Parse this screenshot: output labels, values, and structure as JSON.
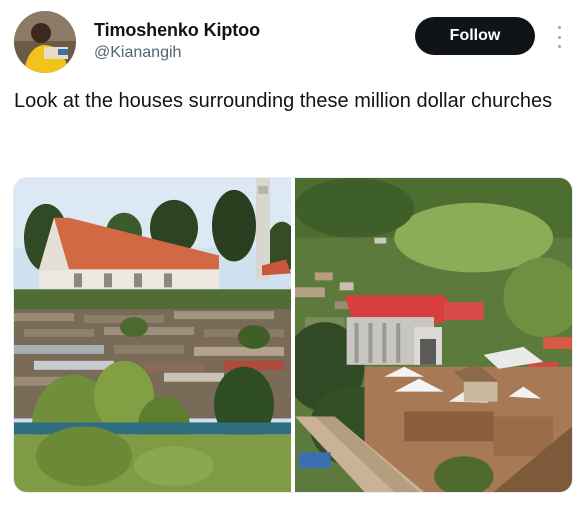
{
  "author": {
    "display_name": "Timoshenko Kiptoo",
    "handle": "@Kianangih",
    "avatar_icon": "user-avatar"
  },
  "actions": {
    "follow_label": "Follow",
    "more_icon": "more-vertical-icon"
  },
  "tweet": {
    "text": "Look at the houses surrounding these million dollar churches"
  },
  "media": {
    "count": 2,
    "photos": [
      {
        "subject": "photo-church-with-surrounding-houses"
      },
      {
        "subject": "photo-aerial-church-on-hillside"
      }
    ]
  },
  "colors": {
    "text_primary": "#0f1419",
    "text_secondary": "#536471",
    "button_bg": "#0f1419",
    "button_text": "#ffffff"
  }
}
